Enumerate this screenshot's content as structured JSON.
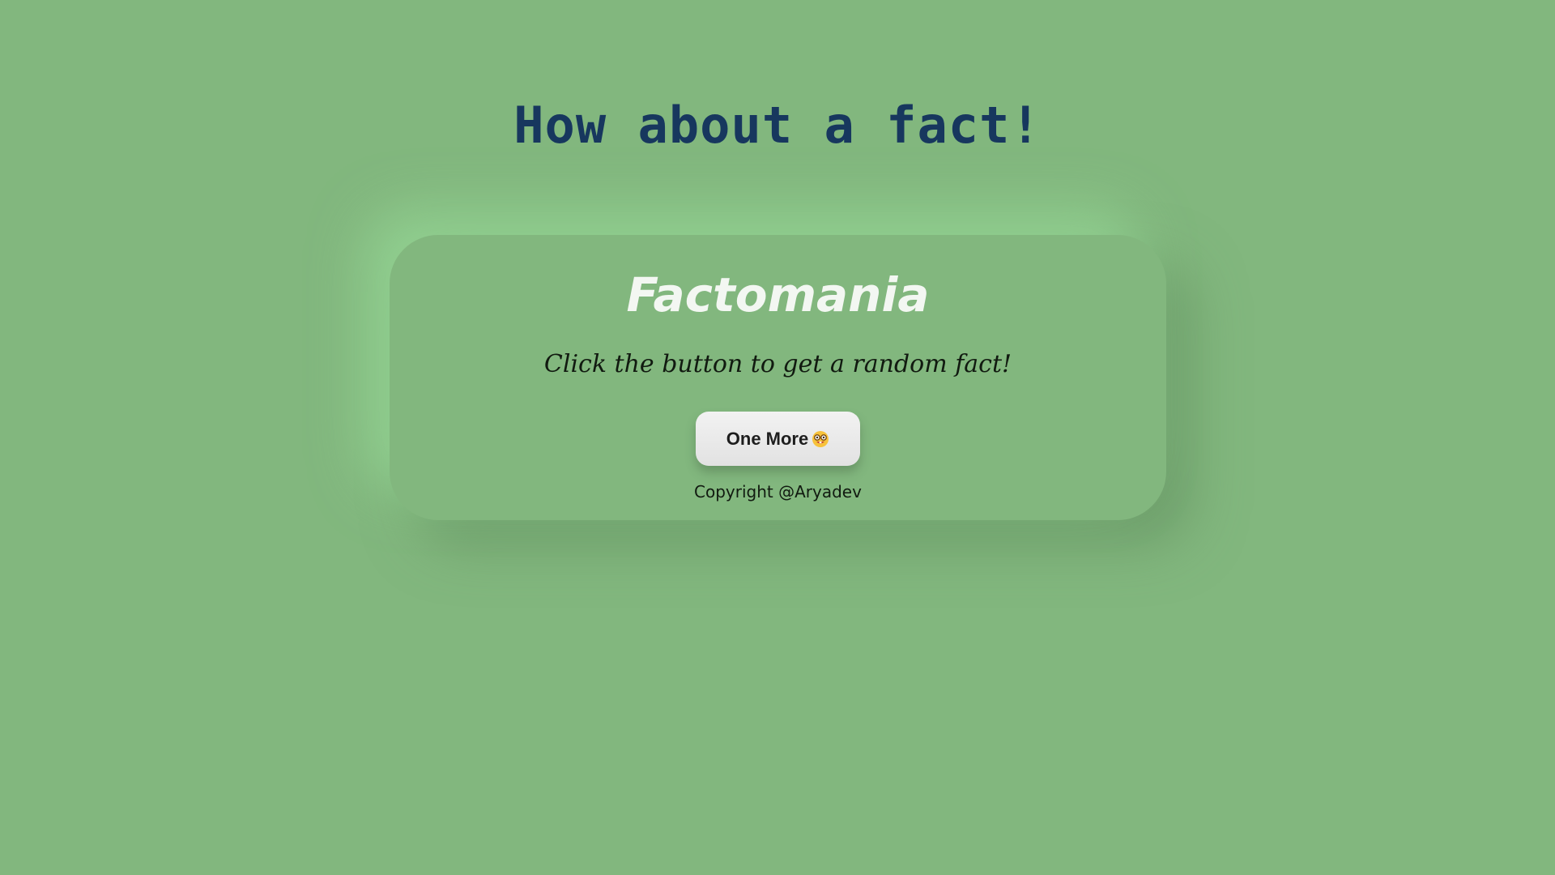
{
  "page": {
    "headline": "How about a fact!"
  },
  "card": {
    "title": "Factomania",
    "subtitle": "Click the button to get a random fact!",
    "button_label": "One More",
    "button_icon": "nerd-face-emoji-icon",
    "copyright": "Copyright @Aryadev"
  },
  "colors": {
    "background": "#82b77e",
    "headline": "#17375e",
    "card_title": "#f3f7f2",
    "button_bg": "#eeeeee"
  }
}
